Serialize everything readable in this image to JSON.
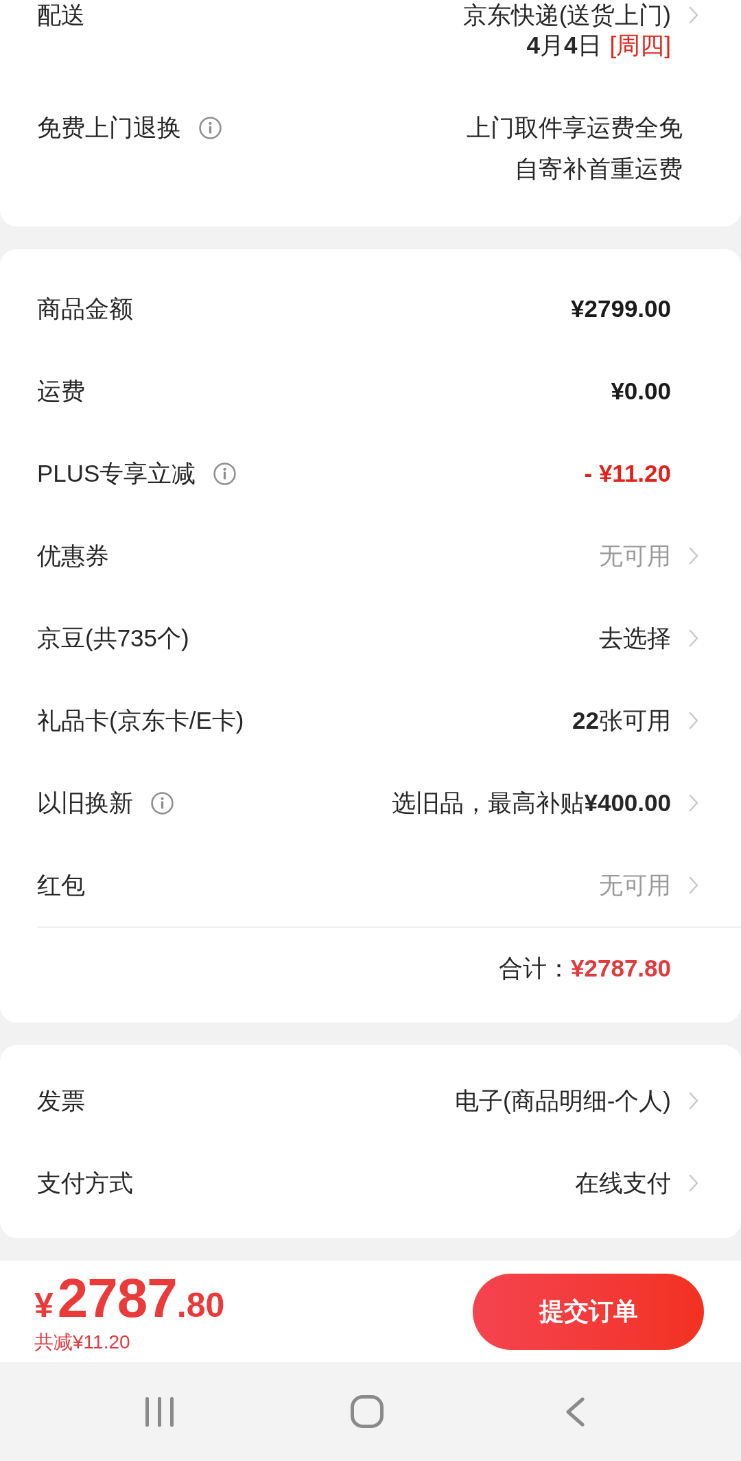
{
  "delivery_card": {
    "shipping": {
      "label": "配送",
      "value": "京东快递(送货上门)",
      "date": "**4**月**4**日",
      "weekday": "[周四]"
    },
    "free_return": {
      "label": "免费上门退换",
      "info": true,
      "lines": [
        "上门取件享运费全免",
        "自寄补首重运费"
      ]
    }
  },
  "price_rows": [
    {
      "label": "商品金额",
      "value": "¥2799.00",
      "kind": "amount",
      "disabled": false
    },
    {
      "label": "运费",
      "value": "¥0.00",
      "kind": "amount",
      "disabled": false
    },
    {
      "label": "PLUS专享立减",
      "info": true,
      "value": "- ¥11.20",
      "kind": "discount",
      "disabled": false
    },
    {
      "label": "优惠券",
      "value": "无可用",
      "kind": "option",
      "disabled": true
    },
    {
      "label": "京豆(共735个)",
      "value": "去选择",
      "kind": "option",
      "disabled": false
    },
    {
      "label": "礼品卡(京东卡/E卡)",
      "value": "**22**张可用",
      "kind": "option",
      "disabled": false
    },
    {
      "label": "以旧换新",
      "info": true,
      "value": "选旧品，最高补贴**¥400.00**",
      "kind": "option",
      "disabled": false
    },
    {
      "label": "红包",
      "value": "无可用",
      "kind": "option",
      "disabled": true
    }
  ],
  "total": {
    "label": "合计：",
    "value": "¥2787.80"
  },
  "invoice_rows": [
    {
      "label": "发票",
      "value": "电子(商品明细-个人)",
      "kind": "option"
    },
    {
      "label": "支付方式",
      "value": "在线支付",
      "kind": "option"
    }
  ],
  "checkout_bar": {
    "currency": "¥",
    "integer": "2787",
    "decimal": ".80",
    "savings": "共减¥11.20",
    "submit": "提交订单"
  }
}
